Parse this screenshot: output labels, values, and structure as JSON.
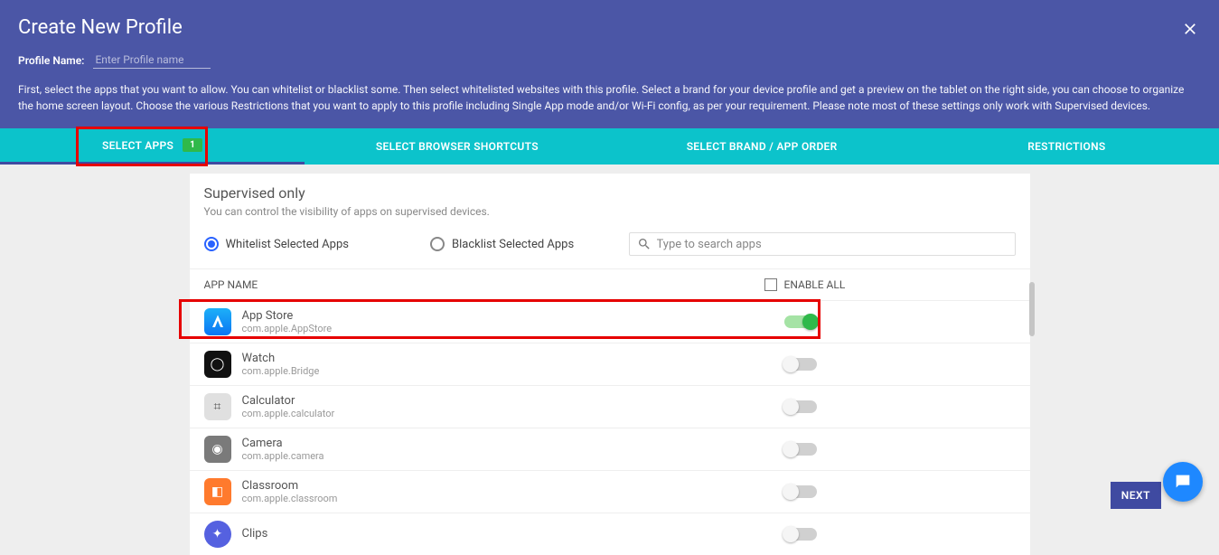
{
  "header": {
    "title": "Create New Profile",
    "profile_label": "Profile Name:",
    "profile_placeholder": "Enter Profile name",
    "description": "First, select the apps that you want to allow. You can whitelist or blacklist some. Then select whitelisted websites with this profile. Select a brand for your device profile and get a preview on the tablet on the right side, you can choose to organize the home screen layout. Choose the various Restrictions that you want to apply to this profile including Single App mode and/or Wi-Fi config, as per your requirement. Please note most of these settings only work with Supervised devices."
  },
  "tabs": {
    "select_apps": "SELECT APPS",
    "select_apps_badge": "1",
    "browser": "SELECT BROWSER SHORTCUTS",
    "brand": "SELECT BRAND / APP ORDER",
    "restrictions": "RESTRICTIONS"
  },
  "section": {
    "title": "Supervised only",
    "subtitle": "You can control the visibility of apps on supervised devices.",
    "radio_whitelist": "Whitelist Selected Apps",
    "radio_blacklist": "Blacklist Selected Apps",
    "search_placeholder": "Type to search apps",
    "col_app": "APP NAME",
    "enable_all": "ENABLE ALL"
  },
  "apps": [
    {
      "name": "App Store",
      "bundle": "com.apple.AppStore",
      "enabled": true
    },
    {
      "name": "Watch",
      "bundle": "com.apple.Bridge",
      "enabled": false
    },
    {
      "name": "Calculator",
      "bundle": "com.apple.calculator",
      "enabled": false
    },
    {
      "name": "Camera",
      "bundle": "com.apple.camera",
      "enabled": false
    },
    {
      "name": "Classroom",
      "bundle": "com.apple.classroom",
      "enabled": false
    },
    {
      "name": "Clips",
      "bundle": "",
      "enabled": false
    }
  ],
  "footer": {
    "next": "NEXT"
  }
}
